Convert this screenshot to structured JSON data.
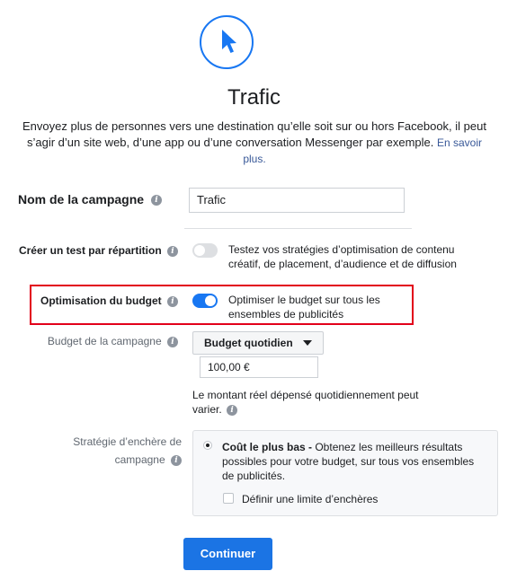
{
  "colors": {
    "accent": "#1877f2",
    "toggle_off": "#dddfe2",
    "highlight_border": "#e2001a",
    "link": "#385898",
    "button": "#1b74e4"
  },
  "header": {
    "icon": "cursor-arrow-icon",
    "title": "Trafic",
    "description": "Envoyez plus de personnes vers une destination qu’elle soit sur ou hors Facebook, il peut s’agir d’un site web, d’une app ou d’une conversation Messenger par exemple.",
    "learn_more": "En savoir plus."
  },
  "campaign_name": {
    "label": "Nom de la campagne",
    "value": "Trafic"
  },
  "split_test": {
    "label": "Créer un test par répartition",
    "enabled": false,
    "description": "Testez vos stratégies d’optimisation de contenu créatif, de placement, d’audience et de diffusion"
  },
  "budget_optimization": {
    "label": "Optimisation du budget",
    "enabled": true,
    "description": "Optimiser le budget sur tous les ensembles de publicités"
  },
  "campaign_budget": {
    "label": "Budget de la campagne",
    "type_select": "Budget quotidien",
    "amount": "100,00 €",
    "note": "Le montant réel dépensé quotidiennement peut varier."
  },
  "bid_strategy": {
    "label": "Stratégie d’enchère de campagne",
    "option_title": "Coût le plus bas -",
    "option_desc": " Obtenez les meilleurs résultats possibles pour votre budget, sur tous vos ensembles de publicités.",
    "bid_cap_label": "Définir une limite d’enchères"
  },
  "footer": {
    "continue_label": "Continuer"
  }
}
